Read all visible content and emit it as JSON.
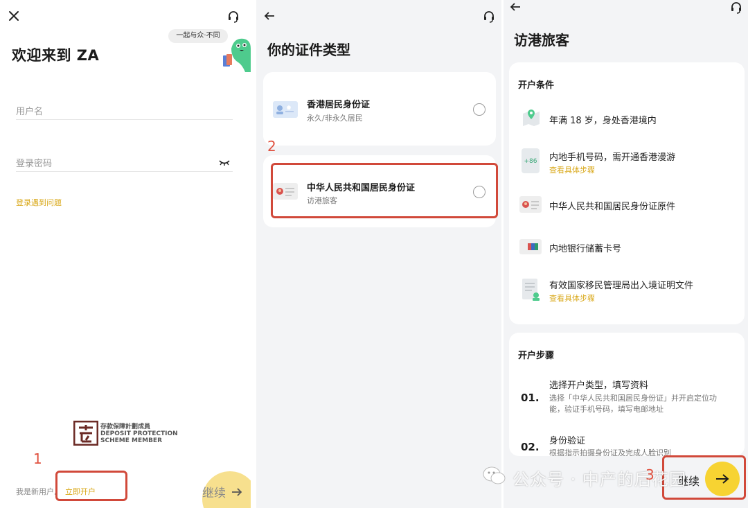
{
  "panel1": {
    "bubble": "一起与众·不同",
    "title": "欢迎来到 ZA",
    "username_placeholder": "用户名",
    "password_placeholder": "登录密码",
    "login_problem": "登录遇到问题",
    "deposit_protection": "存款保障計劃成員",
    "deposit_en_1": "DEPOSIT PROTECTION",
    "deposit_en_2": "SCHEME MEMBER",
    "new_user": "我是新用户,",
    "open_account": "立即开户",
    "continue": "继续",
    "step": "1"
  },
  "panel2": {
    "title": "你的证件类型",
    "options": [
      {
        "name": "香港居民身份证",
        "sub": "永久/非永久居民"
      },
      {
        "name": "中华人民共和国居民身份证",
        "sub": "访港旅客"
      }
    ],
    "step": "2"
  },
  "panel3": {
    "title": "访港旅客",
    "conditions_title": "开户条件",
    "conditions": [
      {
        "text": "年满 18 岁，身处香港境内",
        "link": ""
      },
      {
        "text": "内地手机号码，需开通香港漫游",
        "link": "查看具体步骤"
      },
      {
        "text": "中华人民共和国居民身份证原件",
        "link": ""
      },
      {
        "text": "内地银行储蓄卡号",
        "link": ""
      },
      {
        "text": "有效国家移民管理局出入境证明文件",
        "link": "查看具体步骤"
      }
    ],
    "phone_prefix": "+86",
    "steps_title": "开户步骤",
    "steps": [
      {
        "no": "01.",
        "title": "选择开户类型，填写资料",
        "desc1": "选择「中华人民共和国居民身份证」并开启定位功",
        "desc2": "能，验证手机号码，填写电邮地址"
      },
      {
        "no": "02.",
        "title": "身份验证",
        "desc1": "根据指示拍摄身份证及完成人脸识别",
        "desc2": ""
      }
    ],
    "continue": "继续",
    "step": "3"
  },
  "watermark": "公众号 · 中产的后花园",
  "colors": {
    "accent_yellow": "#d9a819",
    "highlight_red": "#d1493a",
    "button_yellow": "#f7d332",
    "mascot_green": "#4ecb8d"
  }
}
